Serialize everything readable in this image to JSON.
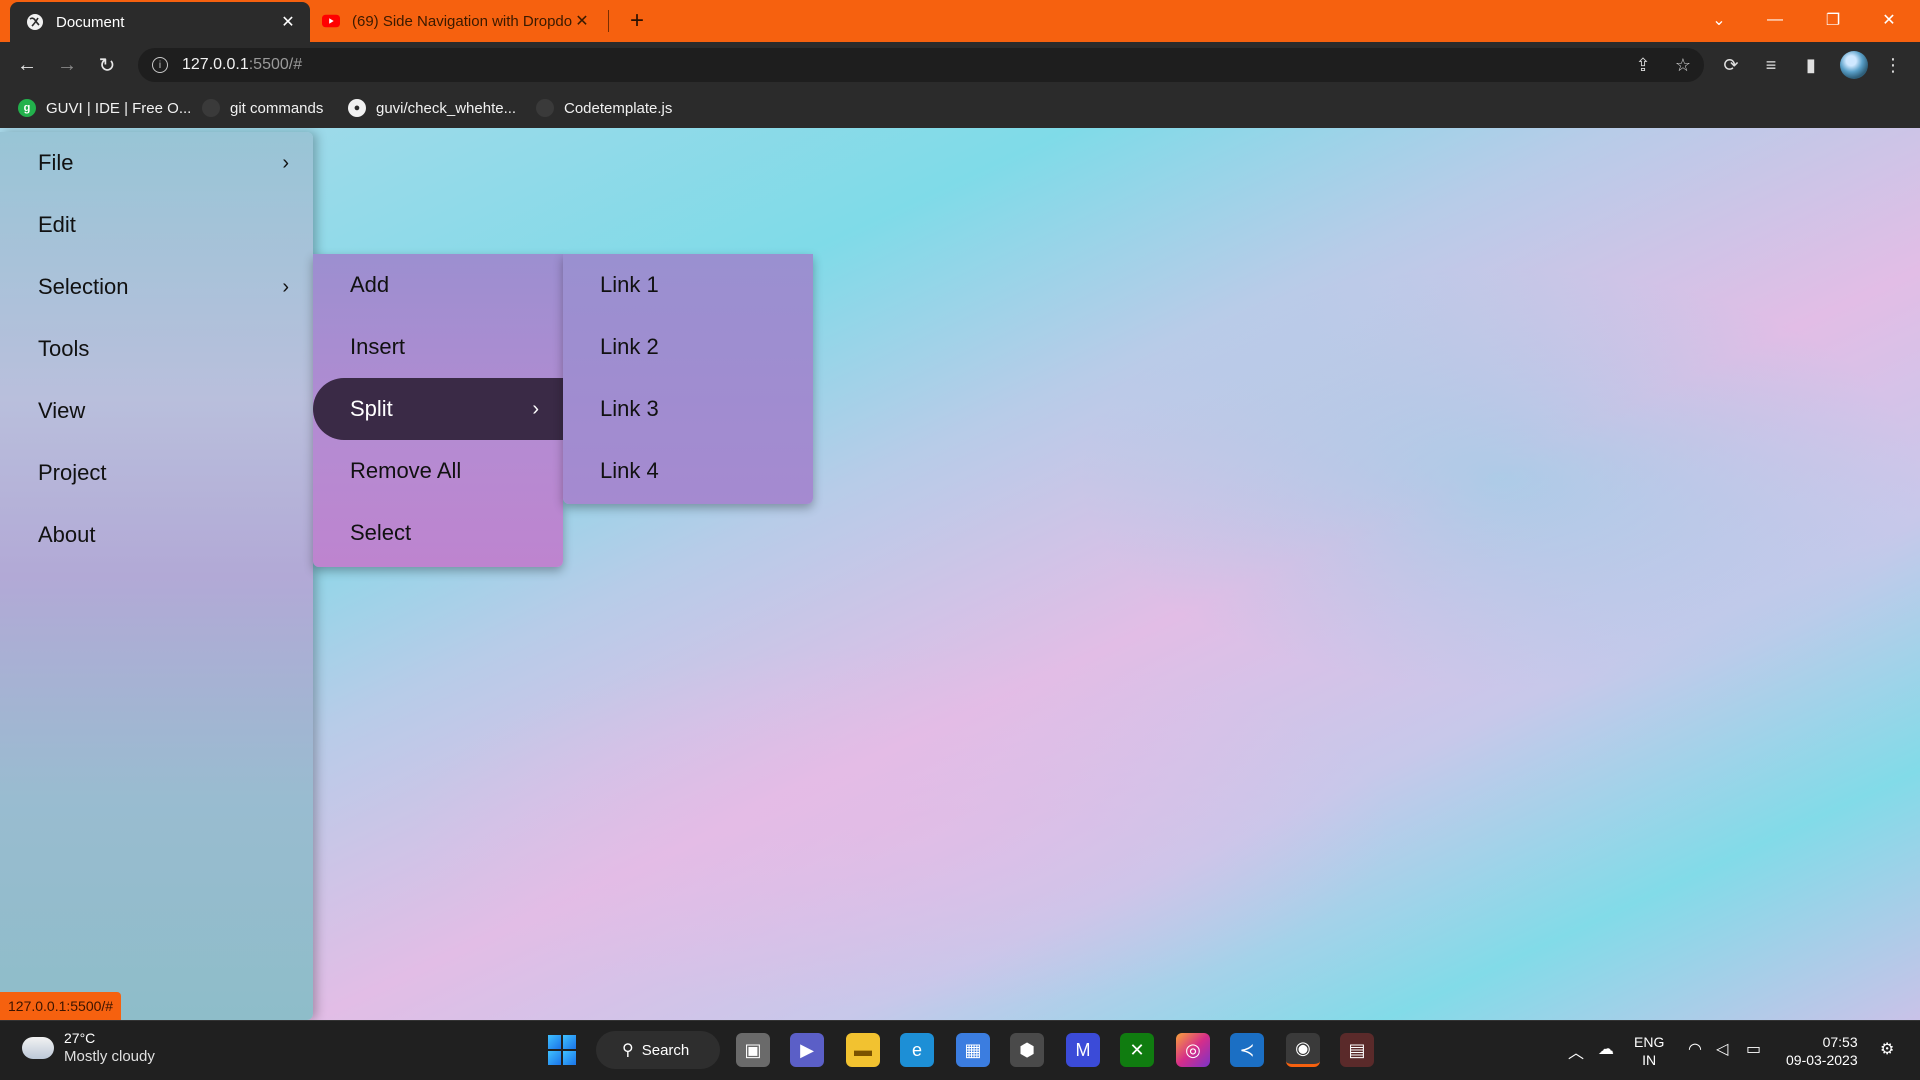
{
  "browser": {
    "tabs": [
      {
        "title": "Document",
        "active": true,
        "favicon": "globe-icon"
      },
      {
        "title": "(69) Side Navigation with Dropdown",
        "active": false,
        "favicon": "youtube-icon"
      }
    ],
    "address": {
      "host": "127.0.0.1",
      "path": ":5500/#"
    },
    "bookmarks": [
      {
        "label": "GUVI | IDE | Free O...",
        "icon": "guvi-icon"
      },
      {
        "label": "git commands",
        "icon": "github-icon"
      },
      {
        "label": "guvi/check_whehte...",
        "icon": "github-icon"
      },
      {
        "label": "Codetemplate.js",
        "icon": "github-icon"
      }
    ],
    "status_url": "127.0.0.1:5500/#"
  },
  "sidenav": {
    "items": [
      {
        "label": "File",
        "has_submenu": true
      },
      {
        "label": "Edit",
        "has_submenu": false
      },
      {
        "label": "Selection",
        "has_submenu": true
      },
      {
        "label": "Tools",
        "has_submenu": false
      },
      {
        "label": "View",
        "has_submenu": false
      },
      {
        "label": "Project",
        "has_submenu": false
      },
      {
        "label": "About",
        "has_submenu": false
      }
    ]
  },
  "submenu1": {
    "items": [
      {
        "label": "Add"
      },
      {
        "label": "Insert"
      },
      {
        "label": "Split",
        "active": true,
        "has_submenu": true
      },
      {
        "label": "Remove All"
      },
      {
        "label": "Select"
      }
    ]
  },
  "submenu2": {
    "items": [
      {
        "label": "Link 1"
      },
      {
        "label": "Link 2"
      },
      {
        "label": "Link 3"
      },
      {
        "label": "Link 4"
      }
    ]
  },
  "taskbar": {
    "weather": {
      "temp": "27°C",
      "condition": "Mostly cloudy"
    },
    "search_label": "Search",
    "lang": {
      "line1": "ENG",
      "line2": "IN"
    },
    "clock": {
      "time": "07:53",
      "date": "09-03-2023"
    }
  },
  "colors": {
    "accent_orange": "#f6610f",
    "active_item": "#3a2a46"
  }
}
